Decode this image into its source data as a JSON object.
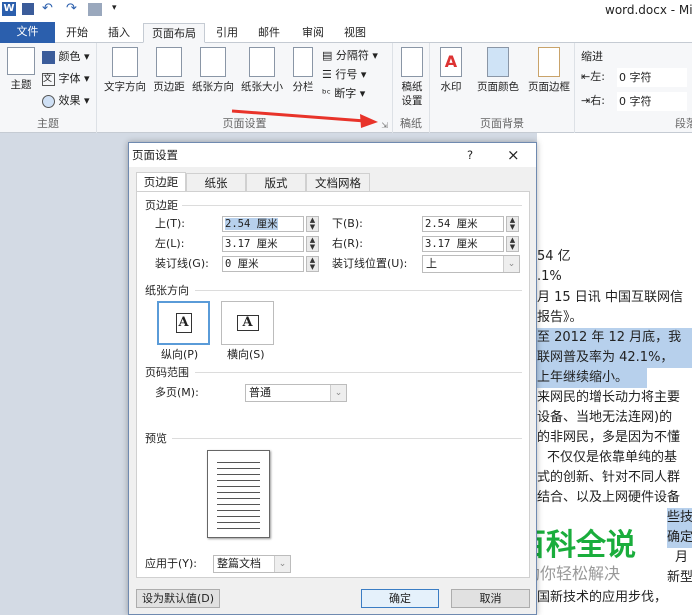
{
  "window": {
    "title": "word.docx - Mic"
  },
  "ribbon": {
    "tabs": [
      "文件",
      "开始",
      "插入",
      "页面布局",
      "引用",
      "邮件",
      "审阅",
      "视图"
    ],
    "active_tab": "页面布局",
    "groups": {
      "theme": {
        "label": "主题",
        "theme_btn": "主题",
        "colors": "颜色",
        "fonts": "字体",
        "effects": "效果"
      },
      "page_setup": {
        "label": "页面设置",
        "text_direction": "文字方向",
        "margins": "页边距",
        "orientation": "纸张方向",
        "size": "纸张大小",
        "columns": "分栏",
        "breaks": "分隔符",
        "line_numbers": "行号",
        "hyphenation": "断字"
      },
      "manuscript": {
        "label": "稿纸",
        "btn_line1": "稿纸",
        "btn_line2": "设置"
      },
      "page_background": {
        "label": "页面背景",
        "watermark": "水印",
        "page_color": "页面颜色",
        "page_borders": "页面边框"
      },
      "paragraph": {
        "label": "段落",
        "indent": "缩进",
        "left_label": "左:",
        "left_value": "0 字符",
        "right_label": "右:",
        "right_value": "0 字符"
      }
    }
  },
  "dialog": {
    "title": "页面设置",
    "help": "?",
    "close": "×",
    "tabs": [
      "页边距",
      "纸张",
      "版式",
      "文档网格"
    ],
    "active_tab": "页边距",
    "margins_section": "页边距",
    "top_label": "上(T):",
    "top_value": "2.54 厘米",
    "bottom_label": "下(B):",
    "bottom_value": "2.54 厘米",
    "left_label": "左(L):",
    "left_value": "3.17 厘米",
    "right_label": "右(R):",
    "right_value": "3.17 厘米",
    "gutter_label": "装订线(G):",
    "gutter_value": "0 厘米",
    "gutter_pos_label": "装订线位置(U):",
    "gutter_pos_value": "上",
    "orientation_section": "纸张方向",
    "portrait": "纵向(P)",
    "landscape": "横向(S)",
    "selected_orientation": "纵向",
    "pages_section": "页码范围",
    "multiple_pages_label": "多页(M):",
    "multiple_pages_value": "普通",
    "preview_section": "预览",
    "apply_to_label": "应用于(Y):",
    "apply_to_value": "整篇文档",
    "set_default": "设为默认值(D)",
    "ok": "确定",
    "cancel": "取消"
  },
  "document": {
    "lines": [
      "54 亿",
      ".1%",
      "月 15 日讯 中国互联网信",
      "报告》。",
      "至 2012 年 12 月底，我",
      "联网普及率为 42.1%，",
      "上年继续缩小。",
      "来网民的增长动力将主要",
      "设备、当地无法连网)的",
      "的非网民，多是因为不懂",
      "不仅仅是依靠单纯的基",
      "式的创新、针对不同人群",
      "结合、以及上网硬件设备",
      "些技",
      "确定",
      "月",
      "新型",
      "国新技术的应用步伐，"
    ]
  },
  "watermark": {
    "title": "百科全说",
    "subtitle": "助你轻松解决",
    "title_color": "#1aad3c"
  },
  "colors": {
    "file_tab": "#2b5fad",
    "selection": "#b7d0ec",
    "arrow": "#e8332a"
  }
}
